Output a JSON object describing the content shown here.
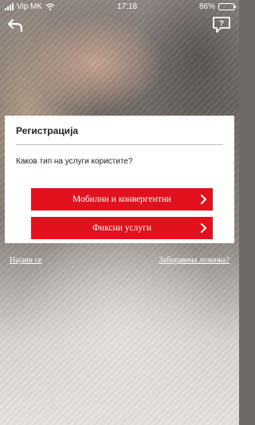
{
  "status_bar": {
    "carrier": "Vip MK",
    "time": "17:18",
    "battery": "86%",
    "battery_level": 0.86
  },
  "nav": {
    "back_icon": "back-arrow-icon",
    "help_icon": "chat-help-icon"
  },
  "card": {
    "title": "Регистрација",
    "question": "Каков тип на услуги користите?",
    "options": [
      {
        "label": "Мобилни и конвергентни"
      },
      {
        "label": "Фиксни услуги"
      }
    ],
    "button_color": "#e1121d"
  },
  "links": {
    "login": "Најави се",
    "forgot_password": "Заборавена лозинка?"
  }
}
